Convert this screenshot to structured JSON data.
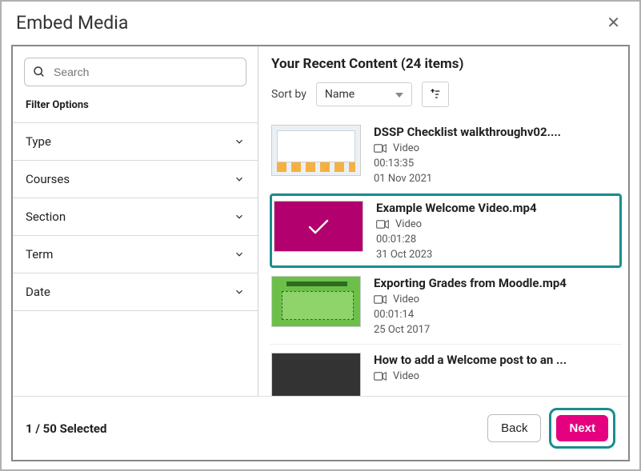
{
  "modal": {
    "title": "Embed Media"
  },
  "search": {
    "placeholder": "Search"
  },
  "filters": {
    "label": "Filter Options",
    "facets": [
      "Type",
      "Courses",
      "Section",
      "Term",
      "Date"
    ]
  },
  "content": {
    "heading_prefix": "Your Recent Content",
    "total_items": 24,
    "sort_label": "Sort by",
    "sort_value": "Name",
    "items": [
      {
        "title": "DSSP Checklist walkthroughv02....",
        "type": "Video",
        "duration": "00:13:35",
        "date": "01 Nov 2021",
        "selected": false,
        "thumb": "dssp"
      },
      {
        "title": "Example Welcome Video.mp4",
        "type": "Video",
        "duration": "00:01:28",
        "date": "31 Oct 2023",
        "selected": true,
        "thumb": "sel"
      },
      {
        "title": "Exporting Grades from Moodle.mp4",
        "type": "Video",
        "duration": "00:01:14",
        "date": "25 Oct 2017",
        "selected": false,
        "thumb": "green"
      },
      {
        "title": "How to add a Welcome post to an ...",
        "type": "Video",
        "duration": "",
        "date": "",
        "selected": false,
        "thumb": "plain"
      }
    ]
  },
  "footer": {
    "selected": 1,
    "max": 50,
    "selected_suffix": "Selected",
    "back_label": "Back",
    "next_label": "Next"
  }
}
